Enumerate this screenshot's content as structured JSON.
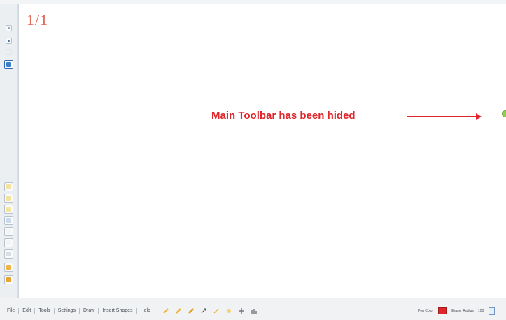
{
  "canvas": {
    "page_counter": "1/1",
    "annotation": {
      "text": "Main Toolbar has been hided",
      "color": "#e0262b"
    }
  },
  "bottom_menu": {
    "items": [
      "File",
      "Edit",
      "Tools",
      "Settings",
      "Draw",
      "Insert Shapes",
      "Help"
    ]
  },
  "status": {
    "pen_color_label": "Pen Color",
    "pen_color": "#e0262b",
    "eraser_label": "Eraser Radius",
    "eraser_value": "100"
  },
  "left_toolbar": {
    "icons": [
      "cursor-icon",
      "pen-icon",
      "divider-icon",
      "image-icon",
      "page-add-icon",
      "page-icon",
      "page-icon",
      "page-icon",
      "page-icon",
      "page-icon",
      "page-icon",
      "folder-icon",
      "save-icon"
    ]
  },
  "bottom_tools": {
    "icons": [
      "pen-icon",
      "highlighter-icon",
      "marker-icon",
      "arrow-icon",
      "line-icon",
      "star-icon",
      "plus-icon",
      "chart-icon"
    ]
  }
}
